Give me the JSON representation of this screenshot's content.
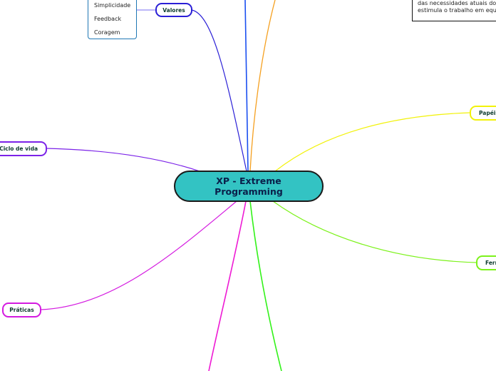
{
  "central": {
    "line1": "XP - Extreme",
    "line2": "Programming",
    "fill": "#33c3c3"
  },
  "branches": [
    {
      "id": "valores",
      "label": "Valores",
      "color": "#2a1fd6"
    },
    {
      "id": "ciclo",
      "label": "Ciclo de vida",
      "color": "#7b22e8"
    },
    {
      "id": "praticas",
      "label": "Práticas",
      "color": "#d41ae0"
    },
    {
      "id": "papeis",
      "label": "Papéis",
      "color": "#f2f20a"
    },
    {
      "id": "ferramentas",
      "label": "Ferr",
      "color": "#7cf21a"
    },
    {
      "id": "top-blue",
      "label": "",
      "color": "#1a4ff0"
    },
    {
      "id": "top-orange",
      "label": "",
      "color": "#f5a020"
    },
    {
      "id": "bottom-pink",
      "label": "",
      "color": "#ee1ad4"
    },
    {
      "id": "bottom-green",
      "label": "",
      "color": "#33f21a"
    }
  ],
  "valores_items": [
    "Simplicidade",
    "Feedback",
    "Coragem"
  ],
  "note": {
    "line1": "das necessidades atuais do",
    "line2": "estimula o trabalho em equ"
  }
}
